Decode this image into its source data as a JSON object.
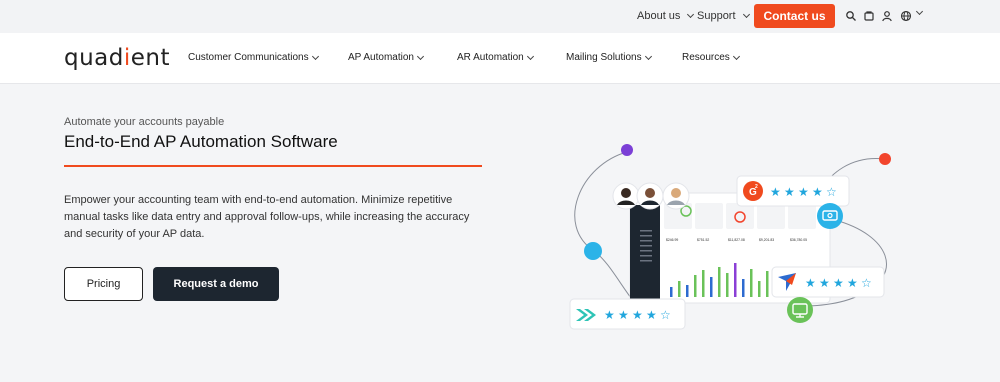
{
  "topbar": {
    "about_label": "About us",
    "support_label": "Support",
    "contact_label": "Contact us"
  },
  "nav": {
    "logo_text_a": "quad",
    "logo_mark": "i",
    "logo_text_b": "ent",
    "items": [
      {
        "label": "Customer Communications"
      },
      {
        "label": "AP Automation"
      },
      {
        "label": "AR Automation"
      },
      {
        "label": "Mailing Solutions"
      },
      {
        "label": "Resources"
      }
    ]
  },
  "hero": {
    "eyebrow": "Automate your accounts payable",
    "title": "End-to-End AP Automation Software",
    "description": "Empower your accounting team with end-to-end automation. Minimize repetitive manual tasks like data entry and approval follow-ups, while increasing the accuracy and security of your AP data.",
    "buttons": {
      "pricing_label": "Pricing",
      "demo_label": "Request a demo"
    }
  },
  "illustration": {
    "g2_badge": "G",
    "g2_sup": "2",
    "dashboard_values": [
      "$246.99",
      "$751.52",
      "$11,827.08",
      "$9,201.83",
      "$36,780.05"
    ],
    "ratings": [
      {
        "source": "g2-rating",
        "stars": 4.5
      },
      {
        "source": "arrow-rating",
        "stars": 4.5
      },
      {
        "source": "chevron-rating",
        "stars": 4.5
      }
    ],
    "colors": {
      "brand_orange": "#f04a1e",
      "star_blue": "#21a6dd",
      "dot_purple": "#7b3fd6",
      "dot_red": "#f2452d",
      "dot_blue": "#2bb3e8",
      "bar_green": "#6ac259",
      "bar_blue": "#2d6bd0",
      "bar_purple": "#8b3fd6"
    }
  }
}
